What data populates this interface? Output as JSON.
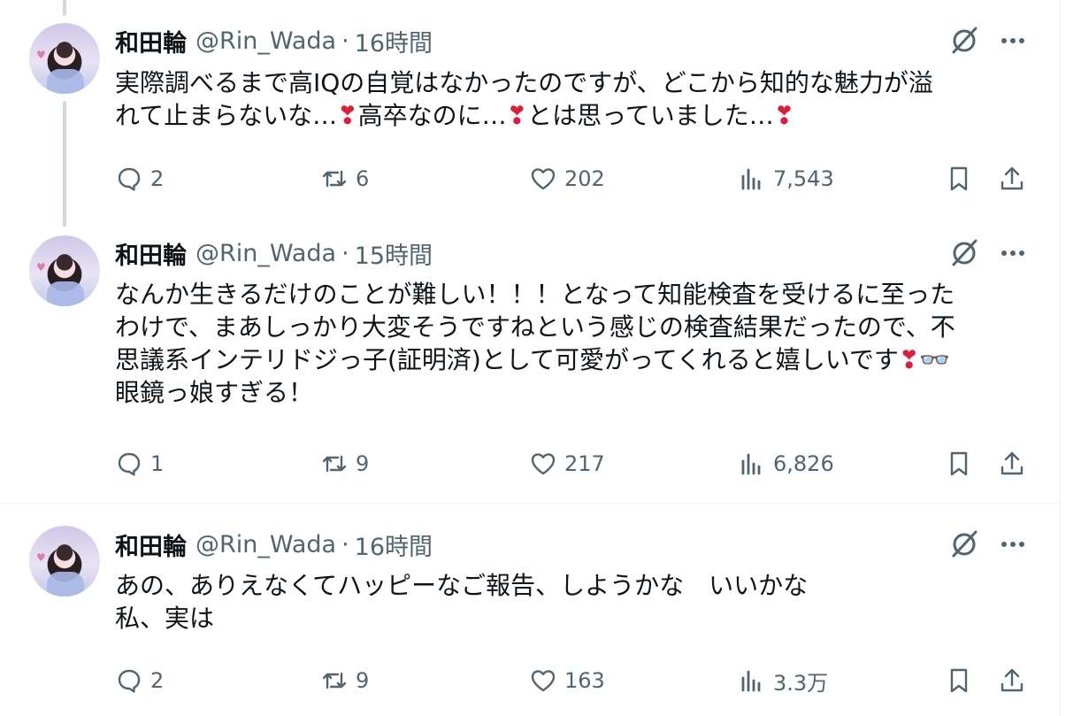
{
  "tweets": [
    {
      "name": "和田輪",
      "handle": "@Rin_Wada",
      "dot": "·",
      "time": "16時間",
      "line1": "実際調べるまで高IQの自覚はなかったのですが、どこから知的な魅力が溢",
      "line2a": "れて止まらないな…",
      "line2b": "高卒なのに…",
      "line2c": "とは思っていました…",
      "emoji": "❣",
      "replies": "2",
      "retweets": "6",
      "likes": "202",
      "views": "7,543"
    },
    {
      "name": "和田輪",
      "handle": "@Rin_Wada",
      "dot": "·",
      "time": "15時間",
      "line1": "なんか生きるだけのことが難しい！！！となって知能検査を受けるに至った",
      "line2": "わけで、まあしっかり大変そうですねという感じの検査結果だったので、不",
      "line3": "思議系インテリドジっ子(証明済)として可愛がってくれると嬉しいです",
      "line3_emoji1": "❣",
      "line3_emoji2": "👓",
      "line4": "眼鏡っ娘すぎる！",
      "replies": "1",
      "retweets": "9",
      "likes": "217",
      "views": "6,826"
    },
    {
      "name": "和田輪",
      "handle": "@Rin_Wada",
      "dot": "·",
      "time": "16時間",
      "line1": "あの、ありえなくてハッピーなご報告、しようかな　いいかな",
      "line2": "私、実は",
      "replies": "2",
      "retweets": "9",
      "likes": "163",
      "views": "3.3万"
    }
  ],
  "colors": {
    "text": "#0f1419",
    "muted": "#536471",
    "thread_line": "#cfd9de",
    "separator": "#eff3f4"
  },
  "icons": [
    "reply-icon",
    "retweet-icon",
    "like-icon",
    "views-icon",
    "bookmark-icon",
    "share-icon",
    "grok-icon",
    "more-icon"
  ]
}
